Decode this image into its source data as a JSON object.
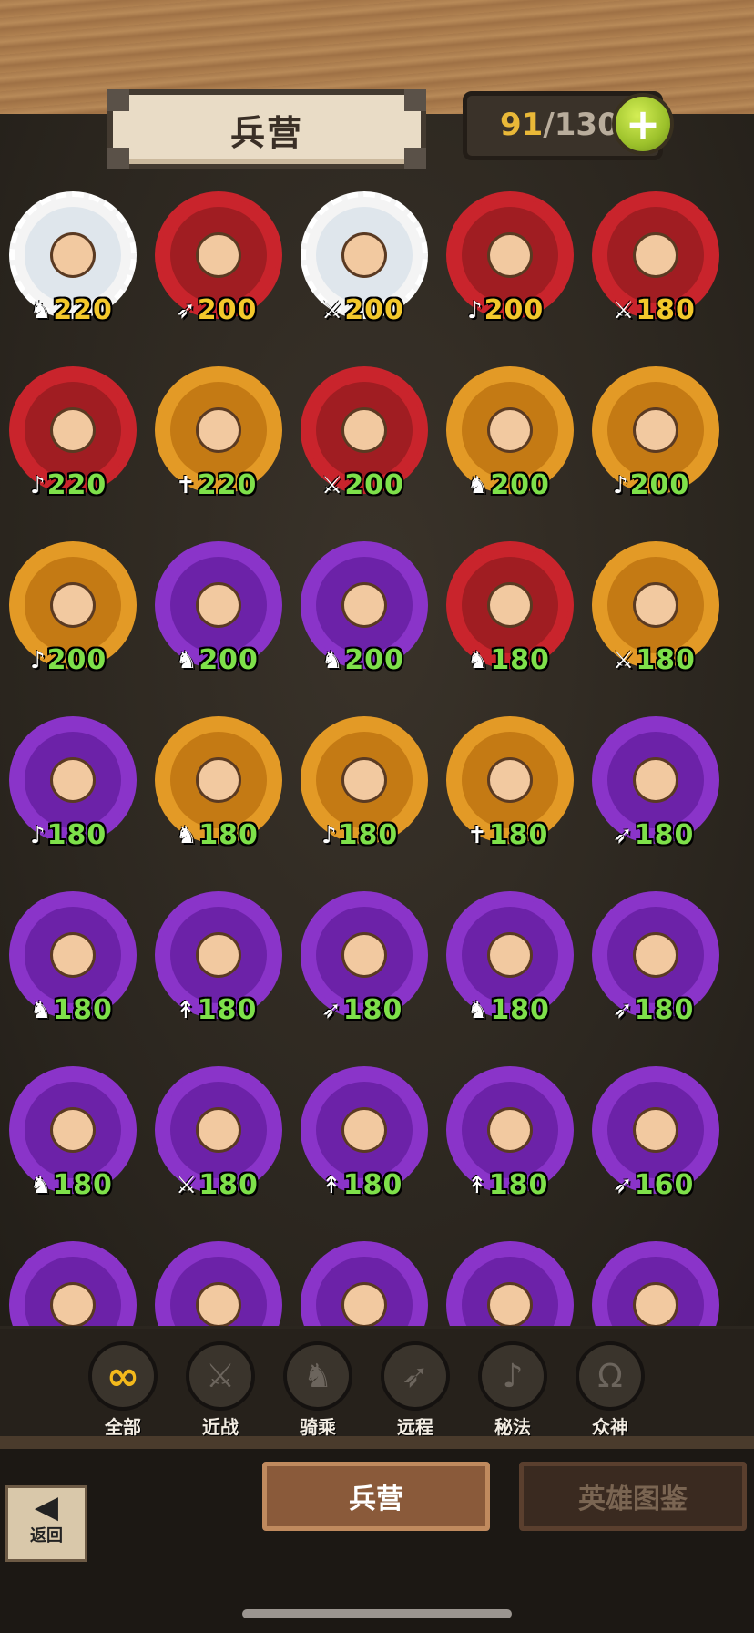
{
  "header": {
    "title": "兵营",
    "unit_count": "91",
    "unit_sep": "/",
    "unit_max": "130",
    "add_label": "+"
  },
  "units": [
    {
      "cost": "220",
      "icon": "cavalry-icon",
      "glyph": "♞",
      "ring": "#f4f4f4",
      "portrait": "#dfe6ec",
      "cost_color": "#f3c82b"
    },
    {
      "cost": "200",
      "icon": "ranged-icon",
      "glyph": "➶",
      "ring": "#c9242c",
      "portrait": "#a01d22",
      "cost_color": "#f3c82b"
    },
    {
      "cost": "200",
      "icon": "melee-icon",
      "glyph": "⚔",
      "ring": "#f4f4f4",
      "portrait": "#dfe6ec",
      "cost_color": "#f3c82b"
    },
    {
      "cost": "200",
      "icon": "magic-icon",
      "glyph": "♪",
      "ring": "#c9242c",
      "portrait": "#a01d22",
      "cost_color": "#f3c82b"
    },
    {
      "cost": "180",
      "icon": "melee-icon",
      "glyph": "⚔",
      "ring": "#c9242c",
      "portrait": "#a01d22",
      "cost_color": "#f3c82b"
    },
    {
      "cost": "220",
      "icon": "magic-icon",
      "glyph": "♪",
      "ring": "#c9242c",
      "portrait": "#a01d22",
      "cost_color": "#7ee04a"
    },
    {
      "cost": "220",
      "icon": "divine-icon",
      "glyph": "✝",
      "ring": "#e39a26",
      "portrait": "#c47a14",
      "cost_color": "#7ee04a"
    },
    {
      "cost": "200",
      "icon": "melee-icon",
      "glyph": "⚔",
      "ring": "#c9242c",
      "portrait": "#a01d22",
      "cost_color": "#7ee04a"
    },
    {
      "cost": "200",
      "icon": "cavalry-icon",
      "glyph": "♞",
      "ring": "#e39a26",
      "portrait": "#c47a14",
      "cost_color": "#7ee04a"
    },
    {
      "cost": "200",
      "icon": "magic-icon",
      "glyph": "♪",
      "ring": "#e39a26",
      "portrait": "#c47a14",
      "cost_color": "#7ee04a"
    },
    {
      "cost": "200",
      "icon": "magic-icon",
      "glyph": "♪",
      "ring": "#e39a26",
      "portrait": "#c47a14",
      "cost_color": "#7ee04a"
    },
    {
      "cost": "200",
      "icon": "hybrid-icon",
      "glyph": "♞",
      "ring": "#8a34c9",
      "portrait": "#6c22a8",
      "cost_color": "#7ee04a"
    },
    {
      "cost": "200",
      "icon": "cavalry-icon",
      "glyph": "♞",
      "ring": "#8a34c9",
      "portrait": "#6c22a8",
      "cost_color": "#7ee04a"
    },
    {
      "cost": "180",
      "icon": "cavalry-icon",
      "glyph": "♞",
      "ring": "#c9242c",
      "portrait": "#a01d22",
      "cost_color": "#7ee04a"
    },
    {
      "cost": "180",
      "icon": "melee-icon",
      "glyph": "⚔",
      "ring": "#e39a26",
      "portrait": "#c47a14",
      "cost_color": "#7ee04a"
    },
    {
      "cost": "180",
      "icon": "magic-icon",
      "glyph": "♪",
      "ring": "#8a34c9",
      "portrait": "#6c22a8",
      "cost_color": "#7ee04a"
    },
    {
      "cost": "180",
      "icon": "cavalry-icon",
      "glyph": "♞",
      "ring": "#e39a26",
      "portrait": "#c47a14",
      "cost_color": "#7ee04a"
    },
    {
      "cost": "180",
      "icon": "magic-icon",
      "glyph": "♪",
      "ring": "#e39a26",
      "portrait": "#c47a14",
      "cost_color": "#7ee04a"
    },
    {
      "cost": "180",
      "icon": "divine-icon",
      "glyph": "✝",
      "ring": "#e39a26",
      "portrait": "#c47a14",
      "cost_color": "#7ee04a"
    },
    {
      "cost": "180",
      "icon": "ranged-icon",
      "glyph": "➶",
      "ring": "#8a34c9",
      "portrait": "#6c22a8",
      "cost_color": "#7ee04a"
    },
    {
      "cost": "180",
      "icon": "cavalry-icon",
      "glyph": "♞",
      "ring": "#8a34c9",
      "portrait": "#6c22a8",
      "cost_color": "#7ee04a"
    },
    {
      "cost": "180",
      "icon": "spear-icon",
      "glyph": "↟",
      "ring": "#8a34c9",
      "portrait": "#6c22a8",
      "cost_color": "#7ee04a"
    },
    {
      "cost": "180",
      "icon": "ranged-icon",
      "glyph": "➶",
      "ring": "#8a34c9",
      "portrait": "#6c22a8",
      "cost_color": "#7ee04a"
    },
    {
      "cost": "180",
      "icon": "hybrid-icon",
      "glyph": "♞",
      "ring": "#8a34c9",
      "portrait": "#6c22a8",
      "cost_color": "#7ee04a"
    },
    {
      "cost": "180",
      "icon": "ranged-icon",
      "glyph": "➶",
      "ring": "#8a34c9",
      "portrait": "#6c22a8",
      "cost_color": "#7ee04a"
    },
    {
      "cost": "180",
      "icon": "cavalry-icon",
      "glyph": "♞",
      "ring": "#8a34c9",
      "portrait": "#6c22a8",
      "cost_color": "#7ee04a"
    },
    {
      "cost": "180",
      "icon": "melee-icon",
      "glyph": "⚔",
      "ring": "#8a34c9",
      "portrait": "#6c22a8",
      "cost_color": "#7ee04a"
    },
    {
      "cost": "180",
      "icon": "spear-icon",
      "glyph": "↟",
      "ring": "#8a34c9",
      "portrait": "#6c22a8",
      "cost_color": "#7ee04a"
    },
    {
      "cost": "180",
      "icon": "spear-icon",
      "glyph": "↟",
      "ring": "#8a34c9",
      "portrait": "#6c22a8",
      "cost_color": "#7ee04a"
    },
    {
      "cost": "160",
      "icon": "ranged-icon",
      "glyph": "➶",
      "ring": "#8a34c9",
      "portrait": "#6c22a8",
      "cost_color": "#7ee04a"
    },
    {
      "cost": "",
      "icon": "",
      "glyph": "",
      "ring": "#8a34c9",
      "portrait": "#6c22a8",
      "cost_color": "#7ee04a"
    },
    {
      "cost": "",
      "icon": "",
      "glyph": "",
      "ring": "#8a34c9",
      "portrait": "#6c22a8",
      "cost_color": "#7ee04a"
    },
    {
      "cost": "",
      "icon": "",
      "glyph": "",
      "ring": "#8a34c9",
      "portrait": "#6c22a8",
      "cost_color": "#7ee04a"
    },
    {
      "cost": "",
      "icon": "",
      "glyph": "",
      "ring": "#8a34c9",
      "portrait": "#6c22a8",
      "cost_color": "#7ee04a"
    },
    {
      "cost": "",
      "icon": "",
      "glyph": "",
      "ring": "#8a34c9",
      "portrait": "#6c22a8",
      "cost_color": "#7ee04a"
    }
  ],
  "filters": [
    {
      "label": "全部",
      "icon": "infinity-icon",
      "glyph": "∞",
      "active": true
    },
    {
      "label": "近战",
      "icon": "sword-icon",
      "glyph": "⚔",
      "active": false
    },
    {
      "label": "骑乘",
      "icon": "horse-icon",
      "glyph": "♞",
      "active": false
    },
    {
      "label": "远程",
      "icon": "bow-icon",
      "glyph": "➶",
      "active": false
    },
    {
      "label": "秘法",
      "icon": "music-icon",
      "glyph": "♪",
      "active": false
    },
    {
      "label": "众神",
      "icon": "omega-icon",
      "glyph": "Ω",
      "active": false
    }
  ],
  "bottom": {
    "back_label": "返回",
    "back_glyph": "◀",
    "tab_barracks": "兵营",
    "tab_codex": "英雄图鉴"
  }
}
